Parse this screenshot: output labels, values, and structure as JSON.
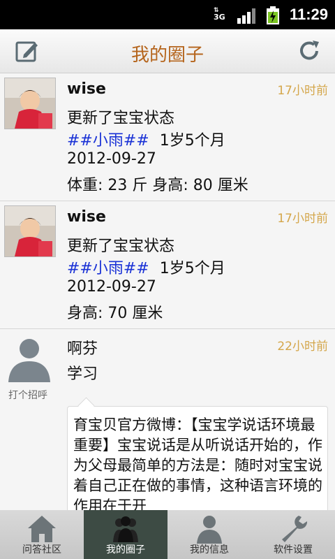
{
  "status_bar": {
    "network": "3G",
    "time": "11:29"
  },
  "header": {
    "title": "我的圈子"
  },
  "posts": [
    {
      "user": "wise",
      "time": "17小时前",
      "lines": [
        "更新了宝宝状态",
        "##小雨##",
        "1岁5个月",
        "2012-09-27",
        "体重: 23 斤 身高: 80 厘米"
      ]
    },
    {
      "user": "wise",
      "time": "17小时前",
      "lines": [
        "更新了宝宝状态",
        "##小雨##",
        "1岁5个月",
        "2012-09-27",
        "身高: 70 厘米"
      ]
    },
    {
      "user": "啊芬",
      "time": "22小时前",
      "greet": "打个招呼",
      "content": "学习",
      "quote": "育宝贝官方微博：【宝宝学说话环境最重要】宝宝说话是从听说话开始的，作为父母最简单的方法是：随时对宝宝说着自己正在做的事情，这种语言环境的作用在于开"
    }
  ],
  "tabs": [
    {
      "label": "问答社区",
      "icon": "house-icon"
    },
    {
      "label": "我的圈子",
      "icon": "people-icon"
    },
    {
      "label": "我的信息",
      "icon": "person-icon"
    },
    {
      "label": "软件设置",
      "icon": "wrench-icon"
    }
  ]
}
